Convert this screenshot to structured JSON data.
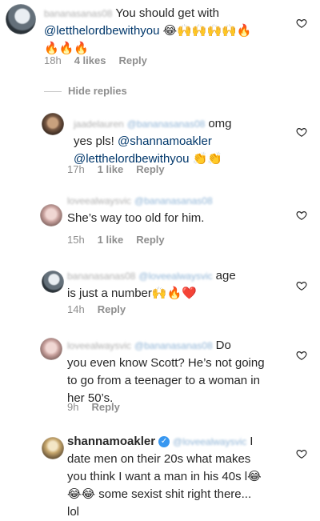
{
  "comments": [
    {
      "username": "bananasanas08",
      "text": "You should get with",
      "mention": "@letthelordbewithyou",
      "emoji": "😂🙌🙌🙌🙌🔥",
      "emoji2": "🔥🔥🔥",
      "time": "18h",
      "likes": "4 likes",
      "reply": "Reply"
    },
    {
      "hide_replies": "Hide replies"
    },
    {
      "username": "jaadelauren",
      "reply_to": "@bananasanas08",
      "text": "omg",
      "text2": "yes pls!",
      "mention1": "@shannamoakler",
      "mention2": "@letthelordbewithyou",
      "emoji": "👏👏",
      "time": "17h",
      "likes": "1 like",
      "reply": "Reply"
    },
    {
      "username": "loveealwaysvic",
      "reply_to": "@bananasanas08",
      "text": "She’s way too old for him.",
      "time": "15h",
      "likes": "1 like",
      "reply": "Reply"
    },
    {
      "username": "bananasanas08",
      "reply_to": "@loveealwaysvic",
      "text": "age",
      "text2": "is just a number",
      "emoji": "🙌🔥❤️",
      "time": "14h",
      "reply": "Reply"
    },
    {
      "username": "loveealwaysvic",
      "reply_to": "@bananasanas08",
      "text": "Do",
      "text2": "you even know Scott? He’s not going",
      "text3": "to go from a teenager to a woman in",
      "text4": "her 50’s.",
      "time": "9h",
      "reply": "Reply"
    },
    {
      "username": "shannamoakler",
      "reply_to": "@loveealwaysvic",
      "text": "I",
      "text2": "date men on their 20s what makes",
      "text3": "you think I want a man in his 40s l",
      "emoji3": "😂",
      "emoji4": "😂😂",
      "text4": " some sexist shit right there...",
      "text5": "lol"
    }
  ],
  "icons": {
    "heart": "heart-icon",
    "verified": "verified-badge-icon"
  },
  "colors": {
    "meta": "#8e8e8e",
    "mention": "#00376b",
    "verified": "#3897f0",
    "text": "#262626"
  }
}
